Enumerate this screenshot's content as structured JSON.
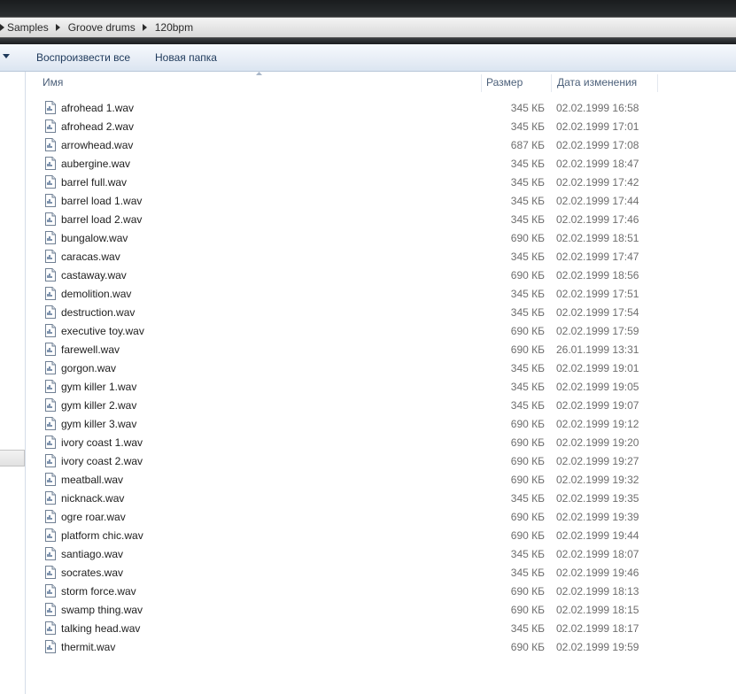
{
  "breadcrumb": [
    "Samples",
    "Groove drums",
    "120bpm"
  ],
  "toolbar": {
    "play_all_label": "Воспроизвести все",
    "new_folder_label": "Новая папка"
  },
  "columns": {
    "name": "Имя",
    "size": "Размер",
    "date": "Дата изменения"
  },
  "icons": {
    "file": "wav-audio-file-icon",
    "crumb_separator": "chevron-right-icon",
    "toolbar_dropdown": "dropdown-arrow-icon",
    "sort": "sort-ascending-icon"
  },
  "colors": {
    "toolbar_text": "#1e395b",
    "header_text": "#4c607a",
    "meta_text": "#6d6d6d"
  },
  "files": [
    {
      "name": "afrohead 1.wav",
      "size": "345 КБ",
      "date": "02.02.1999 16:58"
    },
    {
      "name": "afrohead 2.wav",
      "size": "345 КБ",
      "date": "02.02.1999 17:01"
    },
    {
      "name": "arrowhead.wav",
      "size": "687 КБ",
      "date": "02.02.1999 17:08"
    },
    {
      "name": "aubergine.wav",
      "size": "345 КБ",
      "date": "02.02.1999 18:47"
    },
    {
      "name": "barrel full.wav",
      "size": "345 КБ",
      "date": "02.02.1999 17:42"
    },
    {
      "name": "barrel load 1.wav",
      "size": "345 КБ",
      "date": "02.02.1999 17:44"
    },
    {
      "name": "barrel load 2.wav",
      "size": "345 КБ",
      "date": "02.02.1999 17:46"
    },
    {
      "name": "bungalow.wav",
      "size": "690 КБ",
      "date": "02.02.1999 18:51"
    },
    {
      "name": "caracas.wav",
      "size": "345 КБ",
      "date": "02.02.1999 17:47"
    },
    {
      "name": "castaway.wav",
      "size": "690 КБ",
      "date": "02.02.1999 18:56"
    },
    {
      "name": "demolition.wav",
      "size": "345 КБ",
      "date": "02.02.1999 17:51"
    },
    {
      "name": "destruction.wav",
      "size": "345 КБ",
      "date": "02.02.1999 17:54"
    },
    {
      "name": "executive toy.wav",
      "size": "690 КБ",
      "date": "02.02.1999 17:59"
    },
    {
      "name": "farewell.wav",
      "size": "690 КБ",
      "date": "26.01.1999 13:31"
    },
    {
      "name": "gorgon.wav",
      "size": "345 КБ",
      "date": "02.02.1999 19:01"
    },
    {
      "name": "gym killer 1.wav",
      "size": "345 КБ",
      "date": "02.02.1999 19:05"
    },
    {
      "name": "gym killer 2.wav",
      "size": "345 КБ",
      "date": "02.02.1999 19:07"
    },
    {
      "name": "gym killer 3.wav",
      "size": "690 КБ",
      "date": "02.02.1999 19:12"
    },
    {
      "name": "ivory coast 1.wav",
      "size": "690 КБ",
      "date": "02.02.1999 19:20"
    },
    {
      "name": "ivory coast 2.wav",
      "size": "690 КБ",
      "date": "02.02.1999 19:27"
    },
    {
      "name": "meatball.wav",
      "size": "690 КБ",
      "date": "02.02.1999 19:32"
    },
    {
      "name": "nicknack.wav",
      "size": "345 КБ",
      "date": "02.02.1999 19:35"
    },
    {
      "name": "ogre roar.wav",
      "size": "690 КБ",
      "date": "02.02.1999 19:39"
    },
    {
      "name": "platform chic.wav",
      "size": "690 КБ",
      "date": "02.02.1999 19:44"
    },
    {
      "name": "santiago.wav",
      "size": "345 КБ",
      "date": "02.02.1999 18:07"
    },
    {
      "name": "socrates.wav",
      "size": "345 КБ",
      "date": "02.02.1999 19:46"
    },
    {
      "name": "storm force.wav",
      "size": "690 КБ",
      "date": "02.02.1999 18:13"
    },
    {
      "name": "swamp thing.wav",
      "size": "690 КБ",
      "date": "02.02.1999 18:15"
    },
    {
      "name": "talking head.wav",
      "size": "345 КБ",
      "date": "02.02.1999 18:17"
    },
    {
      "name": "thermit.wav",
      "size": "690 КБ",
      "date": "02.02.1999 19:59"
    }
  ]
}
